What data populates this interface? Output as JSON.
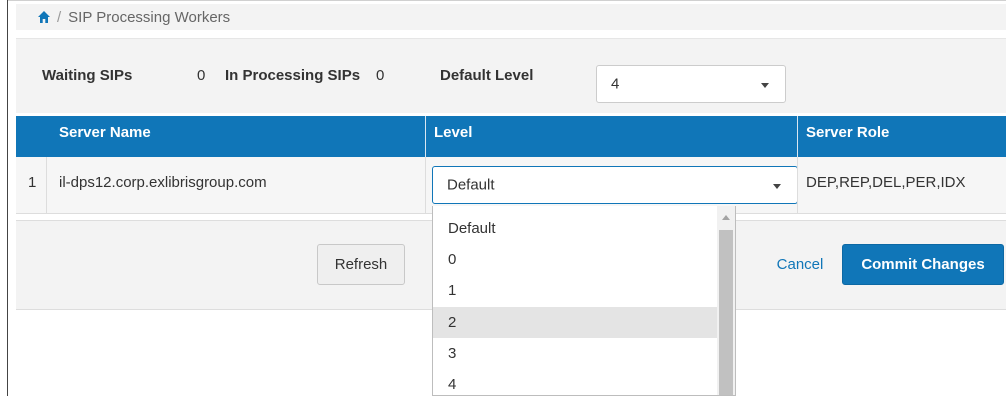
{
  "breadcrumb": {
    "home_icon": "home-icon",
    "separator": "/",
    "current": "SIP Processing Workers"
  },
  "summary": {
    "waiting_label": "Waiting SIPs",
    "waiting_value": "0",
    "processing_label": "In Processing SIPs",
    "processing_value": "0",
    "default_level_label": "Default Level",
    "default_level_value": "4"
  },
  "table": {
    "columns": [
      "Server Name",
      "Level",
      "Server Role"
    ],
    "rows": [
      {
        "index": "1",
        "server_name": "il-dps12.corp.exlibrisgroup.com",
        "level": "Default",
        "server_role": "DEP,REP,DEL,PER,IDX"
      }
    ]
  },
  "level_dropdown": {
    "options": [
      "Default",
      "0",
      "1",
      "2",
      "3",
      "4"
    ],
    "highlighted": "2"
  },
  "buttons": {
    "refresh": "Refresh",
    "cancel": "Cancel",
    "commit": "Commit Changes"
  },
  "colors": {
    "header_blue": "#1076b8",
    "panel_gray": "#f3f3f3"
  }
}
